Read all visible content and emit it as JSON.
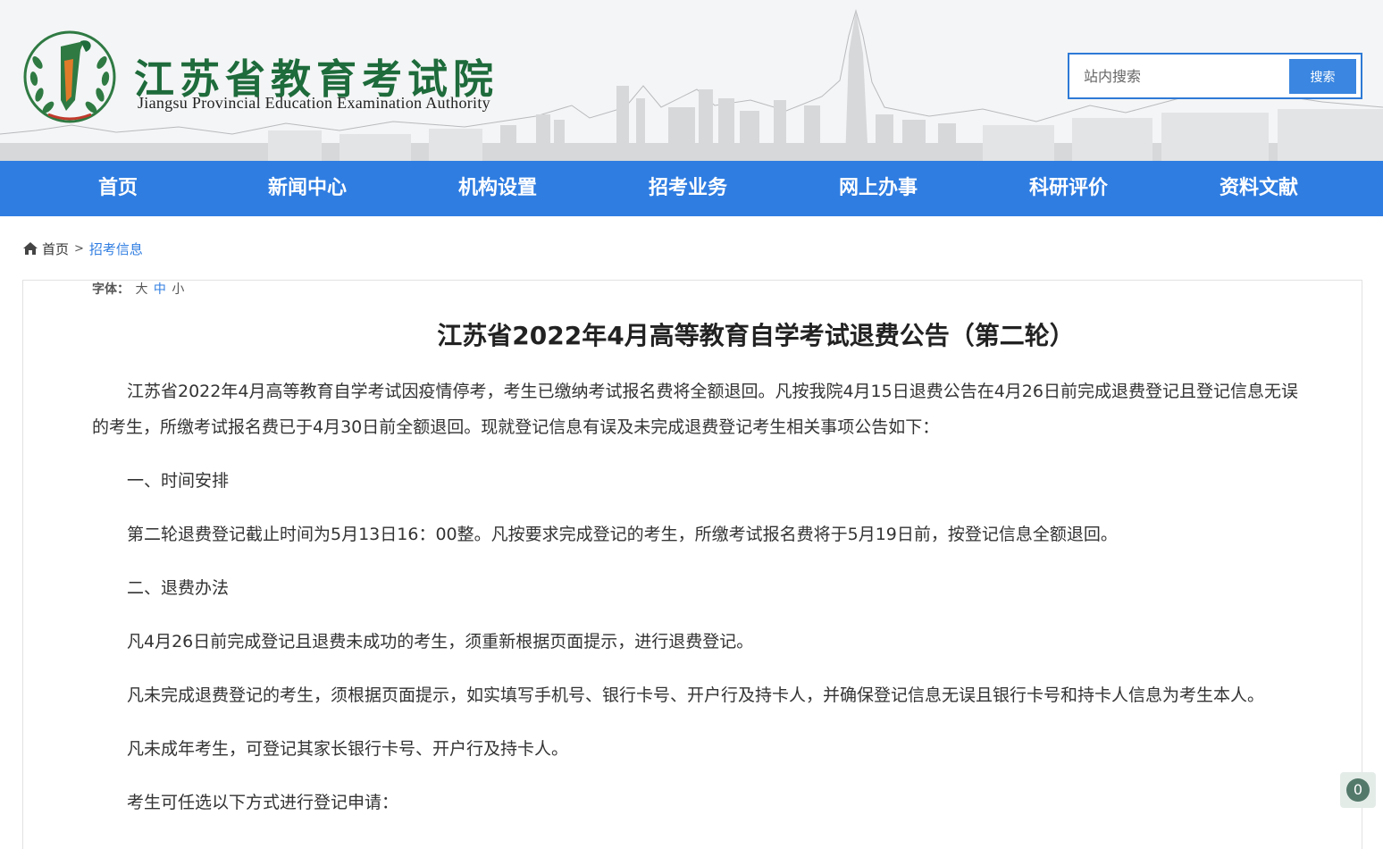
{
  "header": {
    "org_name_cn": "江苏省教育考试院",
    "org_name_en": "Jiangsu Provincial Education Examination Authority",
    "search": {
      "placeholder": "站内搜索",
      "button_label": "搜索"
    }
  },
  "nav": {
    "items": [
      {
        "label": "首页"
      },
      {
        "label": "新闻中心"
      },
      {
        "label": "机构设置"
      },
      {
        "label": "招考业务"
      },
      {
        "label": "网上办事"
      },
      {
        "label": "科研评价"
      },
      {
        "label": "资料文献"
      }
    ]
  },
  "breadcrumb": {
    "home": "首页",
    "separator": ">",
    "current": "招考信息"
  },
  "font_size_bar": {
    "label": "字体：",
    "options": [
      "大",
      "中",
      "小"
    ]
  },
  "article": {
    "title": "江苏省2022年4月高等教育自学考试退费公告（第二轮）",
    "paragraphs": [
      "江苏省2022年4月高等教育自学考试因疫情停考，考生已缴纳考试报名费将全额退回。凡按我院4月15日退费公告在4月26日前完成退费登记且登记信息无误的考生，所缴考试报名费已于4月30日前全额退回。现就登记信息有误及未完成退费登记考生相关事项公告如下：",
      "一、时间安排",
      "第二轮退费登记截止时间为5月13日16：00整。凡按要求完成登记的考生，所缴考试报名费将于5月19日前，按登记信息全额退回。",
      "二、退费办法",
      "凡4月26日前完成登记且退费未成功的考生，须重新根据页面提示，进行退费登记。",
      "凡未完成退费登记的考生，须根据页面提示，如实填写手机号、银行卡号、开户行及持卡人，并确保登记信息无误且银行卡号和持卡人信息为考生本人。",
      "凡未成年考生，可登记其家长银行卡号、开户行及持卡人。",
      "考生可任选以下方式进行登记申请："
    ]
  },
  "badge": {
    "count": "0"
  },
  "colors": {
    "nav_blue": "#2f7de1",
    "logo_green": "#1e6b3b",
    "link_blue": "#2f7de1"
  }
}
